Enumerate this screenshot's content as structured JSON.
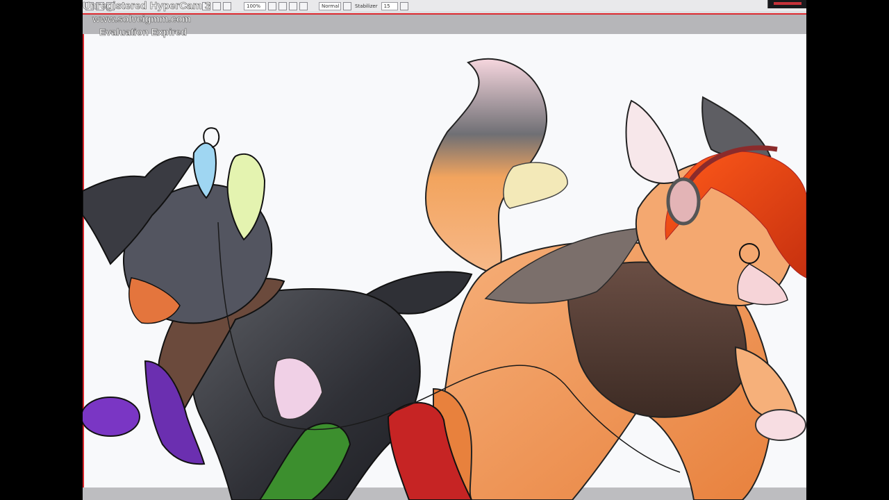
{
  "watermark": {
    "title": "Unregistered HyperCam 3",
    "url": "www.solveigmm.com",
    "status": "Evaluation Expired"
  },
  "toolbar": {
    "zoom_value": "100%",
    "blend_mode": "Normal",
    "stabilizer_label": "Stabilizer",
    "stabilizer_value": "15"
  },
  "colors": {
    "frame_accent": "#d9262c",
    "canvas_bg": "#f8f9fb",
    "outer_bg": "#000000"
  },
  "icons": [
    "new-file-icon",
    "open-icon",
    "save-icon",
    "undo-icon",
    "redo-icon",
    "rotate-icon",
    "flip-icon",
    "blend-icon",
    "stabilizer-icon"
  ]
}
